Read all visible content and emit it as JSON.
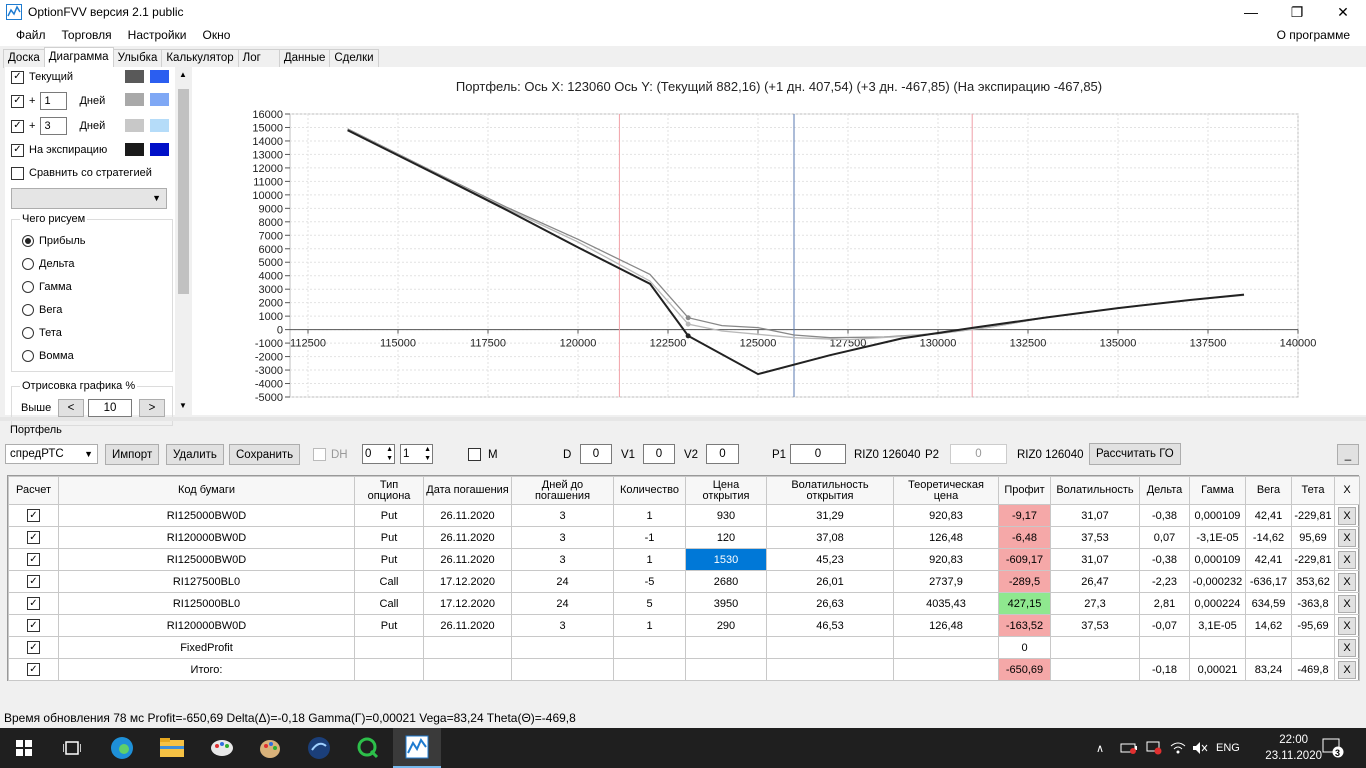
{
  "window": {
    "title": "OptionFVV версия 2.1 public"
  },
  "menu": {
    "items": [
      "Файл",
      "Торговля",
      "Настройки",
      "Окно"
    ],
    "about": "О программе"
  },
  "tabs": [
    "Доска",
    "Диаграмма",
    "Улыбка",
    "Калькулятор",
    "Лог",
    "Данные",
    "Сделки"
  ],
  "left": {
    "current_label": "Текущий",
    "plus1_sign": "+",
    "plus1_value": "1",
    "plus1_unit": "Дней",
    "plus3_sign": "+",
    "plus3_value": "3",
    "plus3_unit": "Дней",
    "expiry_label": "На экспирацию",
    "compare_label": "Сравнить со стратегией",
    "draw_group": "Чего рисуем",
    "radios": [
      "Прибыль",
      "Дельта",
      "Гамма",
      "Вега",
      "Тета",
      "Вомма"
    ],
    "render_group": "Отрисовка графика %",
    "above_label": "Выше",
    "above_value": "10",
    "prev_btn": "<",
    "next_btn": ">"
  },
  "chart_title": "Портфель:  Ось X:  123060  Ось Y:   (Текущий 882,16)   (+1 дн. 407,54)   (+3 дн. -467,85)   (На экспирацию -467,85)",
  "chart_data": {
    "type": "line",
    "xlim": [
      112000,
      140000
    ],
    "ylim": [
      -5000,
      16000
    ],
    "x_ticks": [
      112500,
      115000,
      117500,
      120000,
      122500,
      125000,
      127500,
      130000,
      132500,
      135000,
      137500,
      140000
    ],
    "y_ticks": [
      16000,
      15000,
      14000,
      13000,
      12000,
      11000,
      10000,
      9000,
      8000,
      7000,
      6000,
      5000,
      4000,
      3000,
      2000,
      1000,
      0,
      -1000,
      -2000,
      -3000,
      -4000,
      -5000
    ],
    "vlines": [
      {
        "x": 121150,
        "color": "#f0a0a8"
      },
      {
        "x": 126000,
        "color": "#5a7ab0"
      },
      {
        "x": 130950,
        "color": "#f0a0a8"
      }
    ],
    "series": [
      {
        "color": "#888888",
        "points": [
          [
            113600,
            14900
          ],
          [
            116000,
            11700
          ],
          [
            118000,
            9100
          ],
          [
            120000,
            6700
          ],
          [
            122000,
            4100
          ],
          [
            123060,
            882
          ],
          [
            124000,
            300
          ],
          [
            125000,
            150
          ],
          [
            126000,
            -400
          ],
          [
            127000,
            -600
          ],
          [
            128500,
            -550
          ],
          [
            130000,
            -300
          ],
          [
            131500,
            200
          ],
          [
            133000,
            900
          ],
          [
            135000,
            1600
          ],
          [
            137000,
            2200
          ],
          [
            138500,
            2600
          ]
        ]
      },
      {
        "color": "#b8b8b8",
        "points": [
          [
            113600,
            14850
          ],
          [
            116000,
            11650
          ],
          [
            118000,
            9000
          ],
          [
            120000,
            6500
          ],
          [
            122000,
            3600
          ],
          [
            123060,
            407
          ],
          [
            124000,
            -100
          ],
          [
            125000,
            -350
          ],
          [
            126000,
            -600
          ],
          [
            127500,
            -750
          ],
          [
            129000,
            -500
          ],
          [
            130500,
            -150
          ],
          [
            131500,
            200
          ],
          [
            133000,
            900
          ],
          [
            135000,
            1600
          ],
          [
            137000,
            2200
          ],
          [
            138500,
            2550
          ]
        ]
      },
      {
        "color": "#222222",
        "points": [
          [
            113600,
            14800
          ],
          [
            116000,
            11600
          ],
          [
            118000,
            8900
          ],
          [
            120000,
            6100
          ],
          [
            122000,
            3400
          ],
          [
            123060,
            -467
          ],
          [
            125000,
            -3300
          ],
          [
            127000,
            -1900
          ],
          [
            129000,
            -650
          ],
          [
            131000,
            150
          ],
          [
            133000,
            900
          ],
          [
            135000,
            1600
          ],
          [
            137000,
            2200
          ],
          [
            138500,
            2600
          ]
        ]
      }
    ]
  },
  "portfolio_label": "Портфель",
  "toolbar": {
    "strategy": "спредРТС",
    "import": "Импорт",
    "delete": "Удалить",
    "save": "Сохранить",
    "dh": "DH",
    "spin1": "0",
    "spin2": "1",
    "m": "M",
    "d_label": "D",
    "d_val": "0",
    "v1_label": "V1",
    "v1_val": "0",
    "v2_label": "V2",
    "v2_val": "0",
    "p1_label": "P1",
    "p1_val": "0",
    "riz1": "RIZ0 126040",
    "p2_label": "P2",
    "p2_val": "0",
    "riz2": "RIZ0 126040",
    "calc_go": "Рассчитать ГО",
    "minimize": "_"
  },
  "table": {
    "headers": [
      "Расчет",
      "Код бумаги",
      "Тип опциона",
      "Дата погашения",
      "Дней до погашения",
      "Количество",
      "Цена открытия",
      "Волатильность открытия",
      "Теоретическая цена",
      "Профит",
      "Волатильность",
      "Дельта",
      "Гамма",
      "Вега",
      "Тета",
      "X"
    ],
    "rows": [
      {
        "code": "RI125000BW0D",
        "type": "Put",
        "date": "26.11.2020",
        "days": "3",
        "qty": "1",
        "price": "930",
        "vol_open": "31,29",
        "theo": "920,83",
        "profit": "-9,17",
        "pclass": "neg",
        "vol": "31,07",
        "delta": "-0,38",
        "gamma": "0,000109",
        "vega": "42,41",
        "theta": "-229,81",
        "x": "X"
      },
      {
        "code": "RI120000BW0D",
        "type": "Put",
        "date": "26.11.2020",
        "days": "3",
        "qty": "-1",
        "price": "120",
        "vol_open": "37,08",
        "theo": "126,48",
        "profit": "-6,48",
        "pclass": "neg",
        "vol": "37,53",
        "delta": "0,07",
        "gamma": "-3,1E-05",
        "vega": "-14,62",
        "theta": "95,69",
        "x": "X"
      },
      {
        "code": "RI125000BW0D",
        "type": "Put",
        "date": "26.11.2020",
        "days": "3",
        "qty": "1",
        "price": "1530",
        "vol_open": "45,23",
        "theo": "920,83",
        "profit": "-609,17",
        "pclass": "neg",
        "vol": "31,07",
        "delta": "-0,38",
        "gamma": "0,000109",
        "vega": "42,41",
        "theta": "-229,81",
        "x": "X",
        "selected": true
      },
      {
        "code": "RI127500BL0",
        "type": "Call",
        "date": "17.12.2020",
        "days": "24",
        "qty": "-5",
        "price": "2680",
        "vol_open": "26,01",
        "theo": "2737,9",
        "profit": "-289,5",
        "pclass": "neg",
        "vol": "26,47",
        "delta": "-2,23",
        "gamma": "-0,000232",
        "vega": "-636,17",
        "theta": "353,62",
        "x": "X"
      },
      {
        "code": "RI125000BL0",
        "type": "Call",
        "date": "17.12.2020",
        "days": "24",
        "qty": "5",
        "price": "3950",
        "vol_open": "26,63",
        "theo": "4035,43",
        "profit": "427,15",
        "pclass": "pos",
        "vol": "27,3",
        "delta": "2,81",
        "gamma": "0,000224",
        "vega": "634,59",
        "theta": "-363,8",
        "x": "X"
      },
      {
        "code": "RI120000BW0D",
        "type": "Put",
        "date": "26.11.2020",
        "days": "3",
        "qty": "1",
        "price": "290",
        "vol_open": "46,53",
        "theo": "126,48",
        "profit": "-163,52",
        "pclass": "neg",
        "vol": "37,53",
        "delta": "-0,07",
        "gamma": "3,1E-05",
        "vega": "14,62",
        "theta": "-95,69",
        "x": "X"
      },
      {
        "code": "FixedProfit",
        "type": "",
        "date": "",
        "days": "",
        "qty": "",
        "price": "",
        "vol_open": "",
        "theo": "",
        "profit": "0",
        "pclass": "",
        "vol": "",
        "delta": "",
        "gamma": "",
        "vega": "",
        "theta": "",
        "x": "X"
      },
      {
        "code": "Итого:",
        "type": "",
        "date": "",
        "days": "",
        "qty": "",
        "price": "",
        "vol_open": "",
        "theo": "",
        "profit": "-650,69",
        "pclass": "neg",
        "vol": "",
        "delta": "-0,18",
        "gamma": "0,00021",
        "vega": "83,24",
        "theta": "-469,8",
        "x": "X"
      }
    ]
  },
  "status": "Время обновления 78 мс  Profit=-650,69 Delta(Δ)=-0,18 Gamma(Γ)=0,00021 Vega=83,24 Theta(Θ)=-469,8",
  "taskbar": {
    "lang": "ENG",
    "time": "22:00",
    "date": "23.11.2020",
    "notif": "3"
  }
}
